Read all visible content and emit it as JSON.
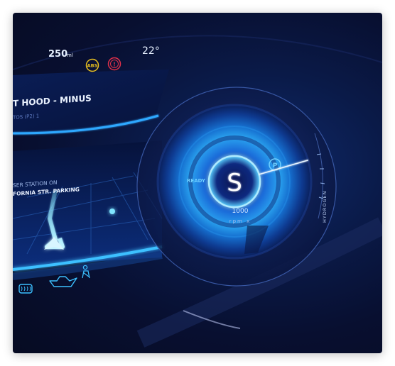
{
  "status_bar": {
    "volume": "250",
    "volume_unit": "ml",
    "abs_label": "ABS",
    "warning_label": "!",
    "temperature": "22°"
  },
  "alert": {
    "title": "T HOOD - MINUS",
    "subtitle": "TOS (P2) 1"
  },
  "navigation": {
    "line1": "SER STATION ON",
    "line2": "FORNIA STR. PARKING"
  },
  "gauge": {
    "gear": "S",
    "ready_label": "READY",
    "park_label": "P",
    "rpm_value": "1000",
    "rpm_unit": "rpm x",
    "needle_fraction": 0.48
  },
  "side_label": "HYDROGEN",
  "bottom_icons": [
    "defrost-icon",
    "oil-can-icon",
    "seatbelt-icon"
  ],
  "colors": {
    "accent": "#2fa8ff",
    "glow": "#9fe4ff",
    "abs": "#e8c020",
    "warning": "#e0304a",
    "background": "#080f30"
  }
}
